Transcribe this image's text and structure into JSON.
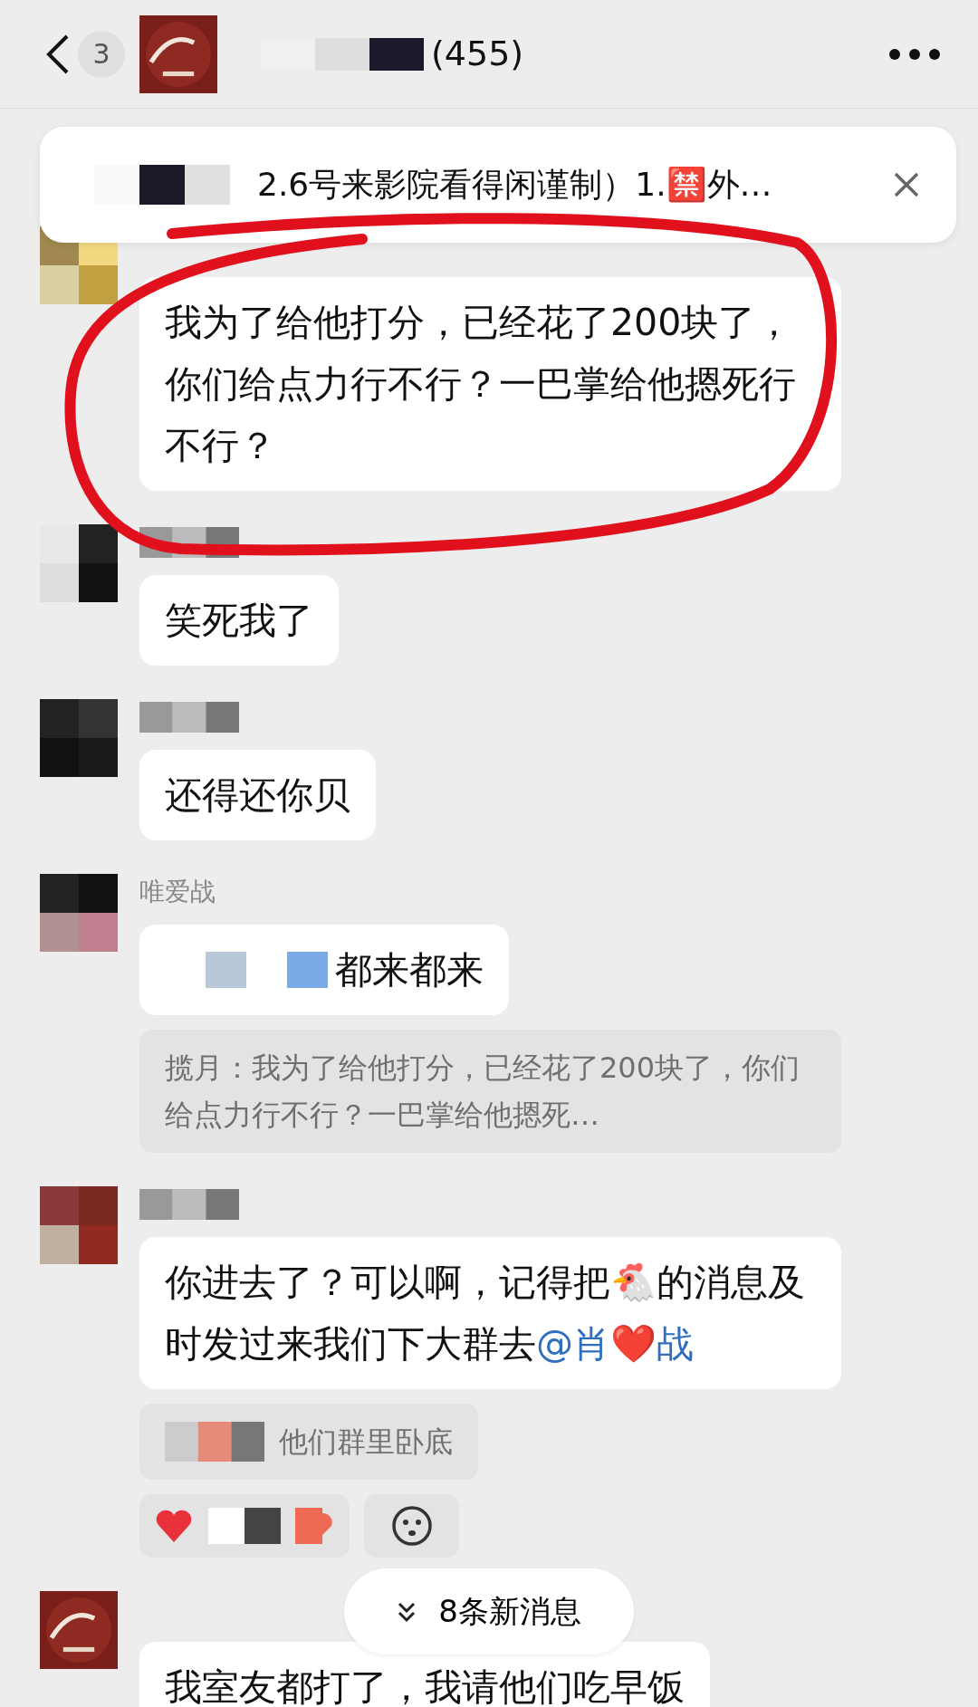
{
  "header": {
    "unread_count": "3",
    "title": "(455)",
    "title_mosaic": true
  },
  "pinned": {
    "text": "2.6号来影院看得闲谨制）1.🈲外…",
    "mosaic": true
  },
  "messages": [
    {
      "avatar_pixelated": true,
      "name_mosaic": false,
      "segments": [
        {
          "kind": "plain",
          "text": "我为了给他打分，已经花了200块了，你们给点力行不行？一巴掌给他摁死行不行？"
        }
      ]
    },
    {
      "avatar_pixelated": true,
      "name_mosaic": true,
      "segments": [
        {
          "kind": "plain",
          "text": "笑死我了"
        }
      ]
    },
    {
      "avatar_pixelated": true,
      "name_mosaic": true,
      "segments": [
        {
          "kind": "plain",
          "text": "还得还你贝"
        }
      ]
    },
    {
      "avatar_pixelated": true,
      "name": "唯爱战",
      "name_mosaic": false,
      "prefix_mosaic": true,
      "segments": [
        {
          "kind": "plain",
          "text": "都来都来"
        }
      ],
      "quote": {
        "text": "揽月：我为了给他打分，已经花了200块了，你们给点力行不行？一巴掌给他摁死…",
        "mosaic": false
      }
    },
    {
      "avatar_pixelated": true,
      "name_mosaic": true,
      "segments": [
        {
          "kind": "plain",
          "text": "你进去了？可以啊，记得把🐔的消息及时发过来我们下大群去"
        },
        {
          "kind": "mention",
          "text": "@肖❤️战"
        }
      ],
      "quote": {
        "text": "他们群里卧底",
        "mosaic": true
      },
      "reactions": true
    },
    {
      "avatar_pixelated": false,
      "name_mosaic": false,
      "segments": [
        {
          "kind": "plain",
          "text": "我室友都打了，我请他们吃早饭"
        }
      ]
    }
  ],
  "new_messages": "8条新消息"
}
